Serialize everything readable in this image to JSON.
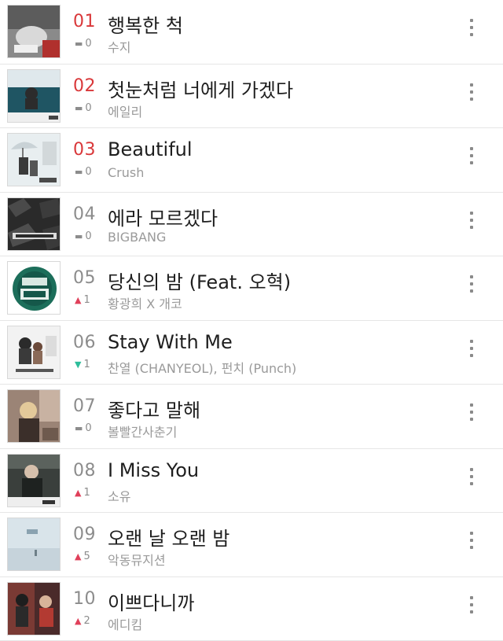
{
  "colors": {
    "top_rank": "#d9383a",
    "rank": "#8c8c8c",
    "up": "#e0405a",
    "down": "#2ebd9b",
    "title": "#1e1e1e",
    "artist": "#9a9a9a"
  },
  "chart": [
    {
      "rank": "01",
      "change": "0",
      "direction": "flat",
      "title": "행복한 척",
      "artist": "수지",
      "thumb": "album-art-gray-portrait"
    },
    {
      "rank": "02",
      "change": "0",
      "direction": "flat",
      "title": "첫눈처럼 너에게 가겠다",
      "artist": "에일리",
      "thumb": "album-art-goblin-ost"
    },
    {
      "rank": "03",
      "change": "0",
      "direction": "flat",
      "title": "Beautiful",
      "artist": "Crush",
      "thumb": "album-art-goblin-umbrella"
    },
    {
      "rank": "04",
      "change": "0",
      "direction": "flat",
      "title": "에라 모르겠다",
      "artist": "BIGBANG",
      "thumb": "album-art-made"
    },
    {
      "rank": "05",
      "change": "1",
      "direction": "up",
      "title": "당신의 밤 (Feat. 오혁)",
      "artist": "황광희 X 개코",
      "thumb": "album-art-great-legacy"
    },
    {
      "rank": "06",
      "change": "1",
      "direction": "down",
      "title": "Stay With Me",
      "artist": "찬열 (CHANYEOL), 펀치 (Punch)",
      "thumb": "album-art-goblin-couple"
    },
    {
      "rank": "07",
      "change": "0",
      "direction": "flat",
      "title": "좋다고 말해",
      "artist": "볼빨간사춘기",
      "thumb": "album-art-blonde-girl"
    },
    {
      "rank": "08",
      "change": "1",
      "direction": "up",
      "title": "I Miss You",
      "artist": "소유",
      "thumb": "album-art-goblin-man"
    },
    {
      "rank": "09",
      "change": "5",
      "direction": "up",
      "title": "오랜 날 오랜 밤",
      "artist": "악동뮤지션",
      "thumb": "album-art-akmu-pale"
    },
    {
      "rank": "10",
      "change": "2",
      "direction": "up",
      "title": "이쁘다니까",
      "artist": "에디킴",
      "thumb": "album-art-eddy-kim"
    }
  ]
}
